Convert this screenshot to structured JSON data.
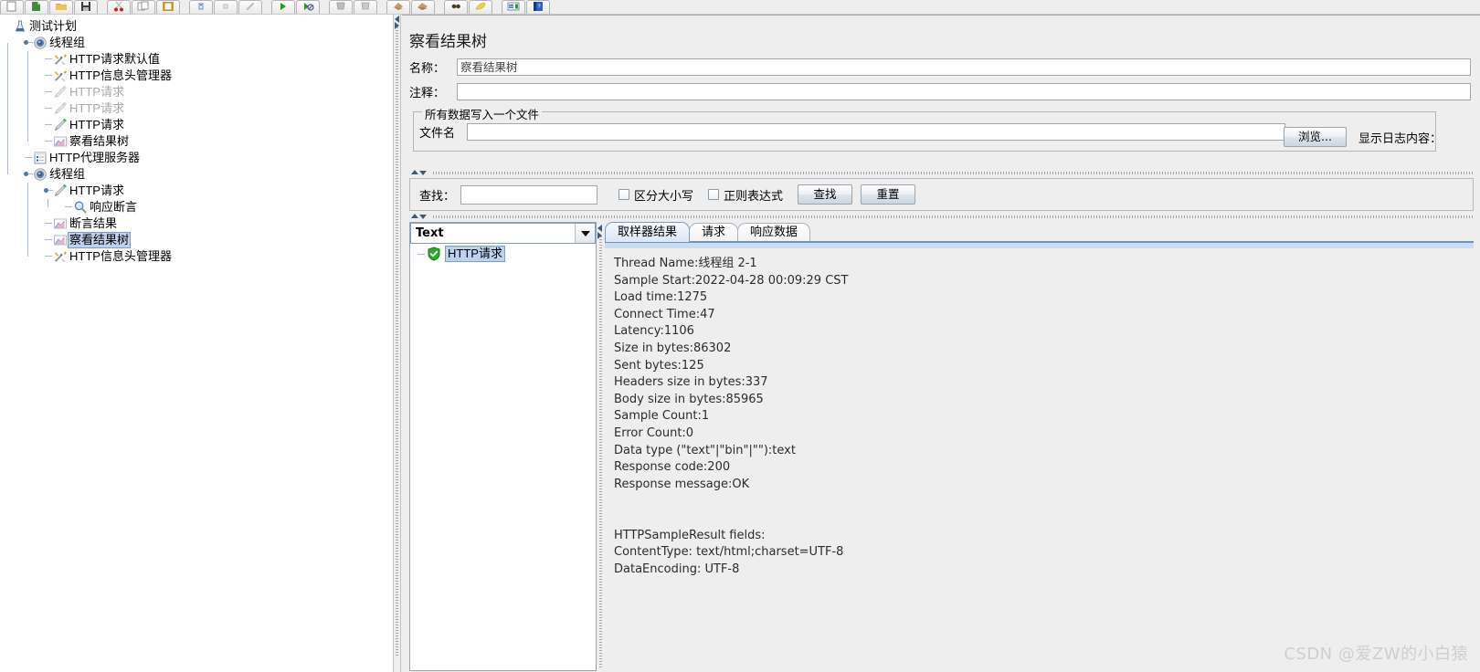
{
  "toolbar": {
    "buttons": [
      {
        "name": "new-icon",
        "glyph": "new"
      },
      {
        "name": "templates-icon",
        "glyph": "templates"
      },
      {
        "name": "open-icon",
        "glyph": "open"
      },
      {
        "name": "save-icon",
        "glyph": "save"
      },
      {
        "name": "cut-icon",
        "glyph": "cut"
      },
      {
        "name": "copy-icon",
        "glyph": "copy"
      },
      {
        "name": "paste-icon",
        "glyph": "paste"
      },
      {
        "name": "expand-icon",
        "glyph": "expand"
      },
      {
        "name": "collapse-icon",
        "glyph": "collapse"
      },
      {
        "name": "toggle-icon",
        "glyph": "toggle"
      },
      {
        "name": "start-icon",
        "glyph": "start"
      },
      {
        "name": "start-no-pause-icon",
        "glyph": "startnp"
      },
      {
        "name": "stop-icon",
        "glyph": "stop"
      },
      {
        "name": "shutdown-icon",
        "glyph": "shutdown"
      },
      {
        "name": "clear-icon",
        "glyph": "clear"
      },
      {
        "name": "clear-all-icon",
        "glyph": "clearall"
      },
      {
        "name": "search-icon",
        "glyph": "search"
      },
      {
        "name": "search-reset-icon",
        "glyph": "searchreset"
      },
      {
        "name": "function-helper-icon",
        "glyph": "fnhelper"
      },
      {
        "name": "help-icon",
        "glyph": "help"
      }
    ]
  },
  "tree": {
    "nodes": [
      {
        "label": "测试计划",
        "icon": "test-plan-icon",
        "depth": 0,
        "state": "normal"
      },
      {
        "label": "线程组",
        "icon": "thread-group-icon",
        "depth": 1,
        "state": "normal"
      },
      {
        "label": "HTTP请求默认值",
        "icon": "config-element-icon",
        "depth": 2,
        "state": "normal"
      },
      {
        "label": "HTTP信息头管理器",
        "icon": "config-element-icon",
        "depth": 2,
        "state": "normal"
      },
      {
        "label": "HTTP请求",
        "icon": "http-sampler-icon",
        "depth": 2,
        "state": "disabled"
      },
      {
        "label": "HTTP请求",
        "icon": "http-sampler-icon",
        "depth": 2,
        "state": "disabled"
      },
      {
        "label": "HTTP请求",
        "icon": "http-sampler-icon",
        "depth": 2,
        "state": "normal"
      },
      {
        "label": "察看结果树",
        "icon": "view-results-tree-icon",
        "depth": 2,
        "state": "normal"
      },
      {
        "label": "HTTP代理服务器",
        "icon": "http-proxy-icon",
        "depth": 1,
        "state": "normal"
      },
      {
        "label": "线程组",
        "icon": "thread-group-icon",
        "depth": 1,
        "state": "normal"
      },
      {
        "label": "HTTP请求",
        "icon": "http-sampler-icon",
        "depth": 2,
        "state": "normal"
      },
      {
        "label": "响应断言",
        "icon": "assertion-icon",
        "depth": 3,
        "state": "normal"
      },
      {
        "label": "断言结果",
        "icon": "view-results-tree-icon",
        "depth": 2,
        "state": "normal"
      },
      {
        "label": "察看结果树",
        "icon": "view-results-tree-icon",
        "depth": 2,
        "state": "selected"
      },
      {
        "label": "HTTP信息头管理器",
        "icon": "config-element-icon",
        "depth": 2,
        "state": "normal"
      }
    ]
  },
  "panel": {
    "title": "察看结果树",
    "name_label": "名称：",
    "name_value": "察看结果树",
    "comment_label": "注释：",
    "comment_value": "",
    "comment_placeholder": "",
    "file_group_title": "所有数据写入一个文件",
    "filename_label": "文件名",
    "filename_value": "",
    "browse_button": "浏览...",
    "log_display_label": "显示日志内容："
  },
  "search": {
    "label": "查找：",
    "value": "",
    "case_sensitive_label": "区分大小写",
    "case_sensitive_checked": false,
    "regex_label": "正则表达式",
    "regex_checked": false,
    "find_button": "查找",
    "reset_button": "重置"
  },
  "results": {
    "renderer_selected": "Text",
    "tree": [
      {
        "label": "HTTP请求",
        "status": "success",
        "selected": true
      }
    ],
    "tabs": [
      {
        "label": "取样器结果",
        "active": true
      },
      {
        "label": "请求",
        "active": false
      },
      {
        "label": "响应数据",
        "active": false
      }
    ],
    "sampler_result_lines": [
      "Thread Name:线程组 2-1",
      "Sample Start:2022-04-28 00:09:29 CST",
      "Load time:1275",
      "Connect Time:47",
      "Latency:1106",
      "Size in bytes:86302",
      "Sent bytes:125",
      "Headers size in bytes:337",
      "Body size in bytes:85965",
      "Sample Count:1",
      "Error Count:0",
      "Data type (\"text\"|\"bin\"|\"\"):text",
      "Response code:200",
      "Response message:OK",
      "",
      "",
      "HTTPSampleResult fields:",
      "ContentType: text/html;charset=UTF-8",
      "DataEncoding: UTF-8"
    ]
  },
  "watermark": "CSDN @爱ZW的小白猿",
  "colors": {
    "window_bg": "#eeeeee",
    "tree_bg": "#ffffff",
    "selection_bg": "#bcd2ee",
    "selection_border": "#7f9db9",
    "tab_active_bg": "#d9e7f7",
    "tab_accent": "#6f93b9",
    "disabled_text": "#a9a9a9",
    "text": "#000000",
    "watermark": "#cfcfcf"
  }
}
